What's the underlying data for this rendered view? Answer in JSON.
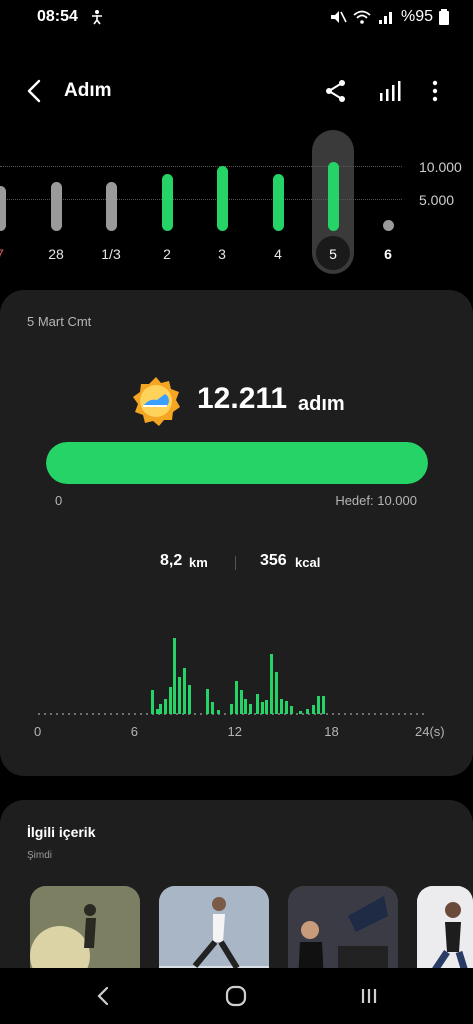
{
  "status_bar": {
    "time": "08:54",
    "battery_text": "%95",
    "icons": [
      "accessibility-icon",
      "mute-icon",
      "wifi-icon",
      "signal-icon",
      "battery-icon"
    ]
  },
  "header": {
    "title": "Adım",
    "icons": [
      "back-arrow-icon",
      "share-icon",
      "stats-icon",
      "more-icon"
    ]
  },
  "day_chart": {
    "goal_label": "10.000",
    "half_label": "5.000",
    "days": [
      {
        "label": "7",
        "steps": 7000,
        "color": "#9a9a9a",
        "label_color": "#e05a5a"
      },
      {
        "label": "28",
        "steps": 7500,
        "color": "#9a9a9a",
        "label_color": "#e6e6e6"
      },
      {
        "label": "1/3",
        "steps": 7500,
        "color": "#9a9a9a",
        "label_color": "#e6e6e6"
      },
      {
        "label": "2",
        "steps": 8700,
        "color": "#25d366",
        "label_color": "#e6e6e6"
      },
      {
        "label": "3",
        "steps": 10000,
        "color": "#25d366",
        "label_color": "#e6e6e6"
      },
      {
        "label": "4",
        "steps": 8700,
        "color": "#25d366",
        "label_color": "#e6e6e6"
      },
      {
        "label": "5",
        "steps": 10600,
        "color": "#25d366",
        "label_color": "#ffffff",
        "selected": true
      },
      {
        "label": "6",
        "steps": 0,
        "color": "#9a9a9a",
        "label_color": "#ffffff",
        "bold": true
      }
    ]
  },
  "summary": {
    "date": "5 Mart Cmt",
    "steps": "12.211",
    "steps_unit": "adım",
    "progress_fraction": 1.0,
    "progress_start": "0",
    "progress_goal": "Hedef: 10.000",
    "distance_value": "8,2",
    "distance_unit": "km",
    "calories_value": "356",
    "calories_unit": "kcal",
    "badge_icon": "shoe-badge-icon"
  },
  "hourly_chart": {
    "x_ticks": [
      "0",
      "6",
      "12",
      "18",
      "24(s)"
    ],
    "values": [
      {
        "hour": 7.0,
        "steps": 25
      },
      {
        "hour": 7.3,
        "steps": 5
      },
      {
        "hour": 7.5,
        "steps": 10
      },
      {
        "hour": 7.8,
        "steps": 15
      },
      {
        "hour": 8.1,
        "steps": 28
      },
      {
        "hour": 8.4,
        "steps": 78
      },
      {
        "hour": 8.7,
        "steps": 38
      },
      {
        "hour": 9.0,
        "steps": 47
      },
      {
        "hour": 9.3,
        "steps": 30
      },
      {
        "hour": 10.4,
        "steps": 26
      },
      {
        "hour": 10.7,
        "steps": 12
      },
      {
        "hour": 11.1,
        "steps": 4
      },
      {
        "hour": 11.9,
        "steps": 10
      },
      {
        "hour": 12.2,
        "steps": 34
      },
      {
        "hour": 12.5,
        "steps": 25
      },
      {
        "hour": 12.8,
        "steps": 15
      },
      {
        "hour": 13.1,
        "steps": 10
      },
      {
        "hour": 13.5,
        "steps": 21
      },
      {
        "hour": 13.8,
        "steps": 12
      },
      {
        "hour": 14.1,
        "steps": 14
      },
      {
        "hour": 14.4,
        "steps": 62
      },
      {
        "hour": 14.7,
        "steps": 43
      },
      {
        "hour": 15.0,
        "steps": 15
      },
      {
        "hour": 15.3,
        "steps": 13
      },
      {
        "hour": 15.6,
        "steps": 8
      },
      {
        "hour": 16.2,
        "steps": 3
      },
      {
        "hour": 16.6,
        "steps": 5
      },
      {
        "hour": 17.0,
        "steps": 9
      },
      {
        "hour": 17.3,
        "steps": 18
      },
      {
        "hour": 17.6,
        "steps": 18
      }
    ],
    "max_steps": 80
  },
  "related": {
    "title": "İlgili içerik",
    "subtitle": "Şimdi",
    "thumbs": [
      {
        "name": "running-thumb",
        "bg": "#6b6f5a"
      },
      {
        "name": "lunge-thumb",
        "bg": "#9aa7b8"
      },
      {
        "name": "gym-thumb",
        "bg": "#3c3c44"
      },
      {
        "name": "stretch-thumb",
        "bg": "#e9e9ec"
      }
    ]
  },
  "nav": {
    "icons": [
      "nav-back-icon",
      "nav-home-icon",
      "nav-recents-icon"
    ]
  }
}
